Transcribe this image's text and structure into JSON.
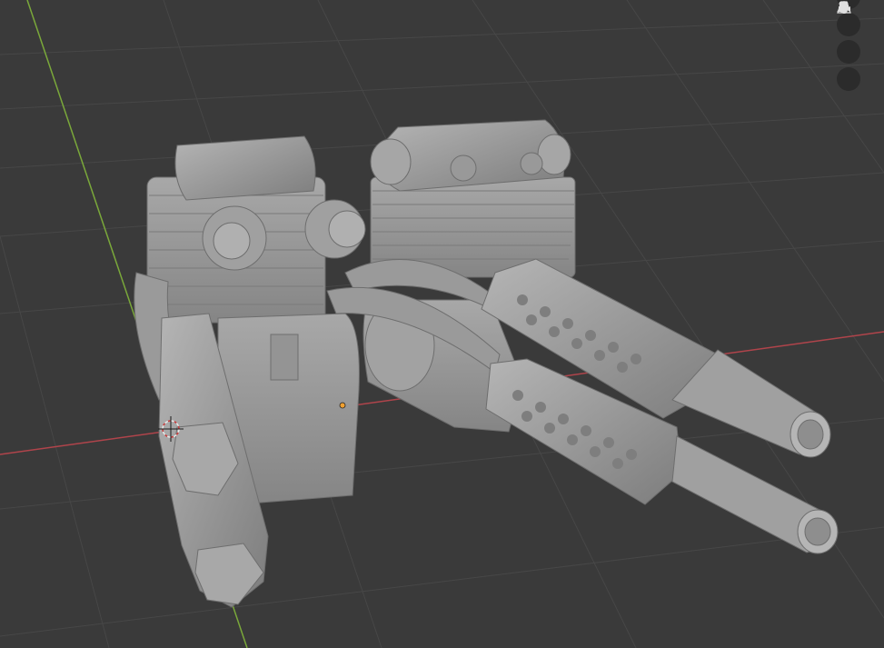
{
  "viewport": {
    "background": "#3a3a3a",
    "grid_color": "#474747",
    "x_axis_color": "#b0444b",
    "y_axis_color": "#7aa83a",
    "object": "motorcycle-engine-model",
    "object_color": "#9a9a9a"
  },
  "navigation_gizmo": [
    {
      "icon": "zoom-icon",
      "tooltip": ""
    },
    {
      "icon": "hand-pan-icon",
      "tooltip": ""
    },
    {
      "icon": "camera-view-icon",
      "tooltip": ""
    },
    {
      "icon": "perspective-grid-icon",
      "tooltip": ""
    }
  ]
}
